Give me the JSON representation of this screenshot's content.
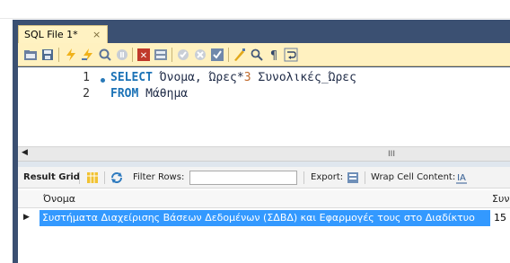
{
  "window": {
    "tab_label": "SQL File 1*",
    "tab_close": "×"
  },
  "toolbar": {
    "icons": [
      "open-folder-icon",
      "save-icon",
      "execute-icon",
      "execute-current-icon",
      "explain-icon",
      "stop-icon",
      "error-stop-icon",
      "toggle-output-icon",
      "commit-icon",
      "rollback-icon",
      "autocommit-icon",
      "beautify-icon",
      "find-icon",
      "invisible-chars-icon",
      "wrap-icon"
    ]
  },
  "editor": {
    "lines": [
      {
        "number": "1",
        "keyword": "SELECT",
        "text_a": " Όνομα, Ώρες*",
        "num": "3",
        "text_b": " Συνολικές_Ώρες"
      },
      {
        "number": "2",
        "keyword": "FROM",
        "text_a": " Μάθημα"
      }
    ]
  },
  "scrollbar": {
    "thumb_label": "III",
    "left_arrow": "◀"
  },
  "results_bar": {
    "result_grid": "Result Grid",
    "filter_rows": "Filter Rows:",
    "filter_value": "",
    "export": "Export:",
    "wrap_cell": "Wrap Cell Content:"
  },
  "grid": {
    "columns": [
      "Όνομα",
      "Συνολι"
    ],
    "rows": [
      {
        "name": "Συστήματα Διαχείρισης Βάσεων Δεδομένων (ΣΔΒΔ) και Εφαρμογές τους στο Διαδίκτυο",
        "total": "15"
      }
    ]
  },
  "colors": {
    "frame": "#3b5072",
    "tab_bg": "#fff2c2",
    "keyword": "#1b72b6",
    "number": "#c06a2b",
    "selection": "#3399ff"
  }
}
